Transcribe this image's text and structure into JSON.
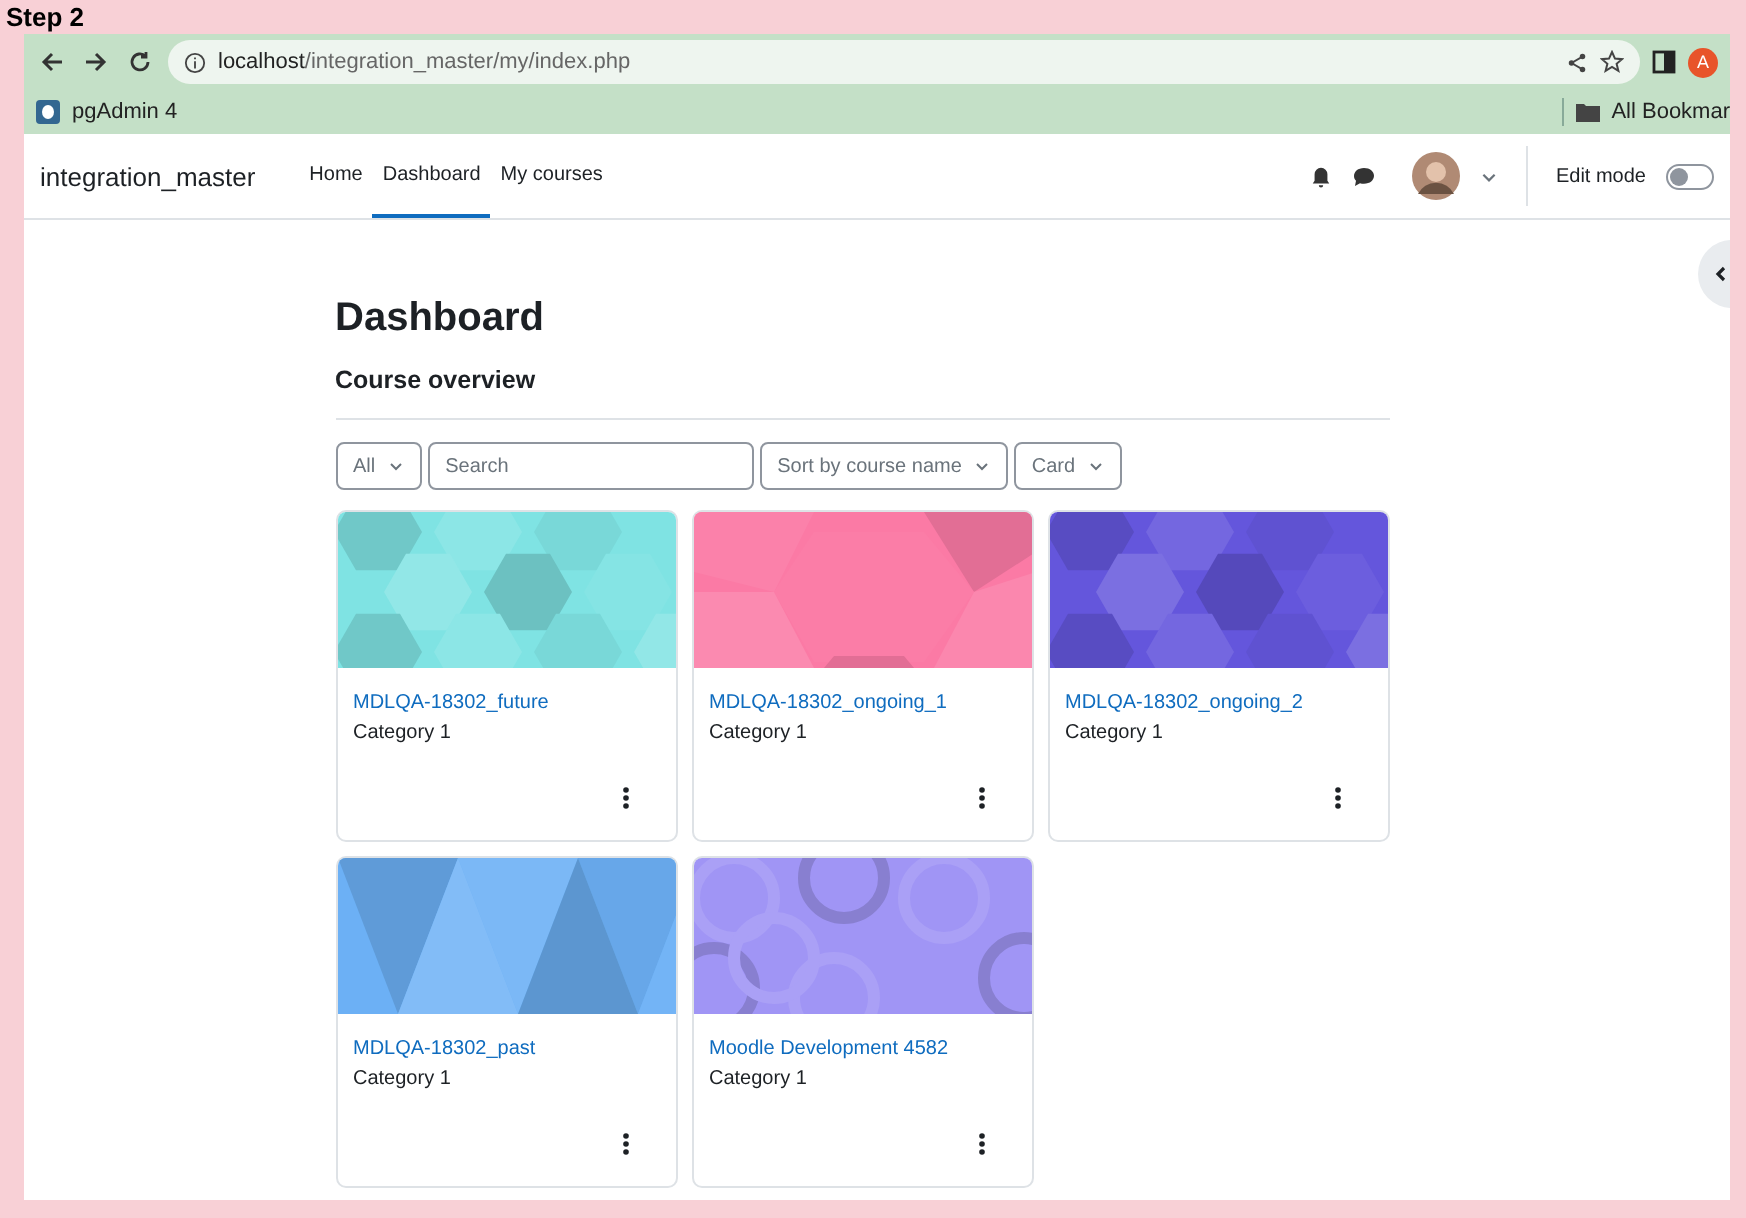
{
  "step_label": "Step 2",
  "browser": {
    "url_host": "localhost",
    "url_path": "/integration_master/my/index.php",
    "profile_initial": "A",
    "bookmarks": [
      {
        "label": "pgAdmin 4"
      }
    ],
    "all_bookmarks": "All Bookmar"
  },
  "site": {
    "name": "integration_master",
    "nav": [
      {
        "label": "Home",
        "selected": false
      },
      {
        "label": "Dashboard",
        "selected": true
      },
      {
        "label": "My courses",
        "selected": false
      }
    ],
    "edit_mode": {
      "label": "Edit mode",
      "on": false
    }
  },
  "page": {
    "title": "Dashboard",
    "section": "Course overview",
    "filters": {
      "grouping": "All",
      "search_placeholder": "Search",
      "sort": "Sort by course name",
      "view": "Card"
    },
    "courses": [
      {
        "name": "MDLQA-18302_future",
        "category": "Category 1",
        "kind": "hexagons",
        "color": "#7fe3e3"
      },
      {
        "name": "MDLQA-18302_ongoing_1",
        "category": "Category 1",
        "kind": "mosaic",
        "color": "#fb7aa5"
      },
      {
        "name": "MDLQA-18302_ongoing_2",
        "category": "Category 1",
        "kind": "hexagons",
        "color": "#6456dc"
      },
      {
        "name": "MDLQA-18302_past",
        "category": "Category 1",
        "kind": "triangles",
        "color": "#6cb0f5"
      },
      {
        "name": "Moodle Development 4582",
        "category": "Category 1",
        "kind": "rings",
        "color": "#a095f5"
      }
    ]
  }
}
